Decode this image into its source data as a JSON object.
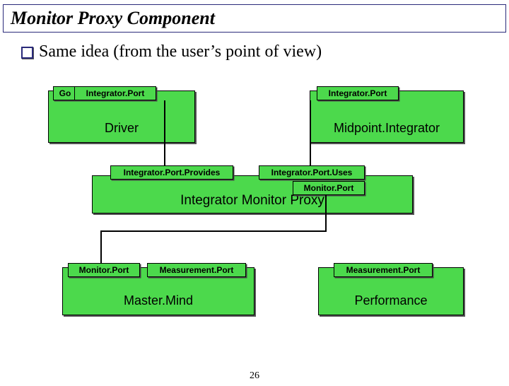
{
  "title": "Monitor Proxy Component",
  "subtitle": "Same idea (from the user’s point of view)",
  "page_number": "26",
  "components": {
    "driver": {
      "label": "Driver",
      "ports": {
        "go": "Go",
        "integrator": "Integrator.Port"
      }
    },
    "midpoint": {
      "label": "Midpoint.Integrator",
      "ports": {
        "integrator": "Integrator.Port"
      }
    },
    "proxy": {
      "label": "Integrator Monitor Proxy",
      "ports": {
        "provides": "Integrator.Port.Provides",
        "uses": "Integrator.Port.Uses",
        "monitor": "Monitor.Port"
      }
    },
    "mastermind": {
      "label": "Master.Mind",
      "ports": {
        "monitor": "Monitor.Port",
        "measure": "Measurement.Port"
      }
    },
    "performance": {
      "label": "Performance",
      "ports": {
        "measure": "Measurement.Port"
      }
    }
  }
}
